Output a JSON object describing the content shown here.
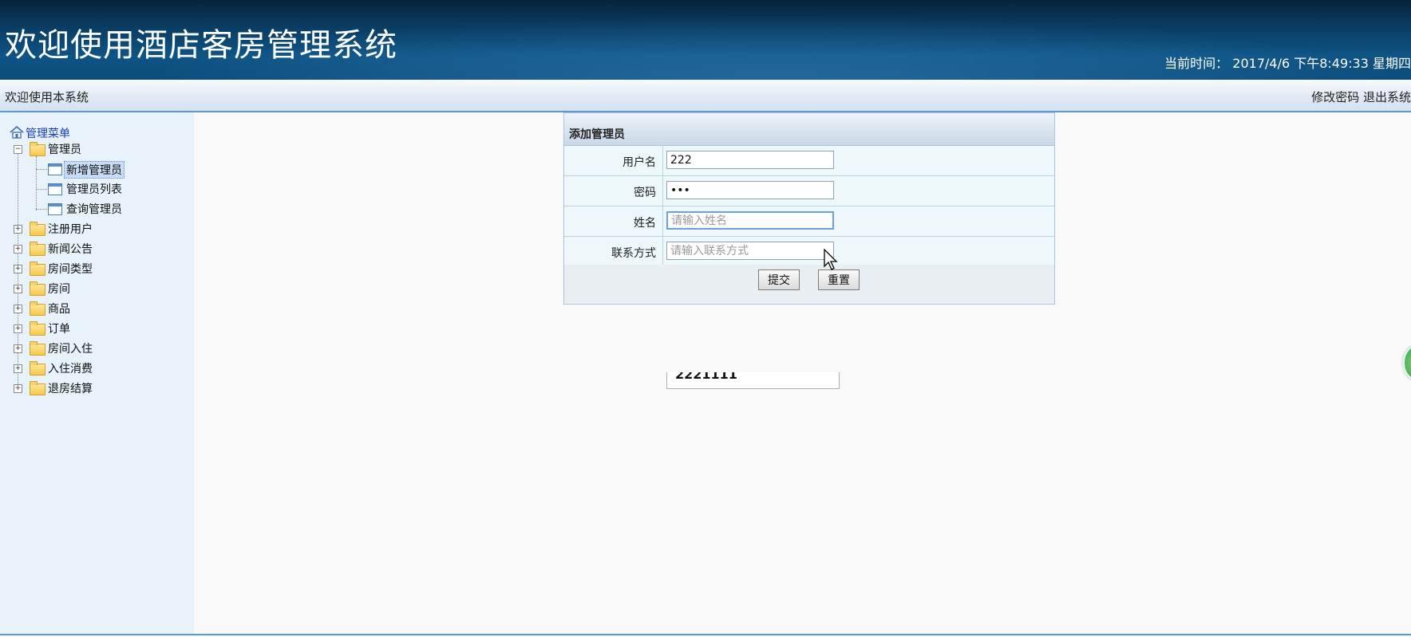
{
  "header": {
    "title": "欢迎使用酒店客房管理系统",
    "time_label": "当前时间：",
    "time_value": "2017/4/6 下午8:49:33 星期四"
  },
  "subbar": {
    "welcome": "欢迎使用本系统",
    "change_password": "修改密码",
    "logout": "退出系统"
  },
  "sidebar": {
    "root_label": "管理菜单",
    "groups": [
      {
        "label": "管理员",
        "expanded": true,
        "children": [
          "新增管理员",
          "管理员列表",
          "查询管理员"
        ]
      },
      {
        "label": "注册用户"
      },
      {
        "label": "新闻公告"
      },
      {
        "label": "房间类型"
      },
      {
        "label": "房间"
      },
      {
        "label": "商品"
      },
      {
        "label": "订单"
      },
      {
        "label": "房间入住"
      },
      {
        "label": "入住消费"
      },
      {
        "label": "退房结算"
      }
    ],
    "selected": "新增管理员"
  },
  "form": {
    "title": "添加管理员",
    "fields": [
      {
        "label": "用户名",
        "value": "222",
        "placeholder": ""
      },
      {
        "label": "密码",
        "value": "222",
        "placeholder": ""
      },
      {
        "label": "姓名",
        "value": "",
        "placeholder": "请输入姓名"
      },
      {
        "label": "联系方式",
        "value": "",
        "placeholder": "请输入联系方式"
      }
    ],
    "submit_label": "提交",
    "reset_label": "重置"
  },
  "autocomplete": {
    "suggestion": "2221111"
  },
  "colors": {
    "header_dark": "#0a3d64",
    "accent_blue": "#5b9bd5",
    "sidebar_bg": "#e8f2fb",
    "form_row_bg": "#eef7f9"
  }
}
